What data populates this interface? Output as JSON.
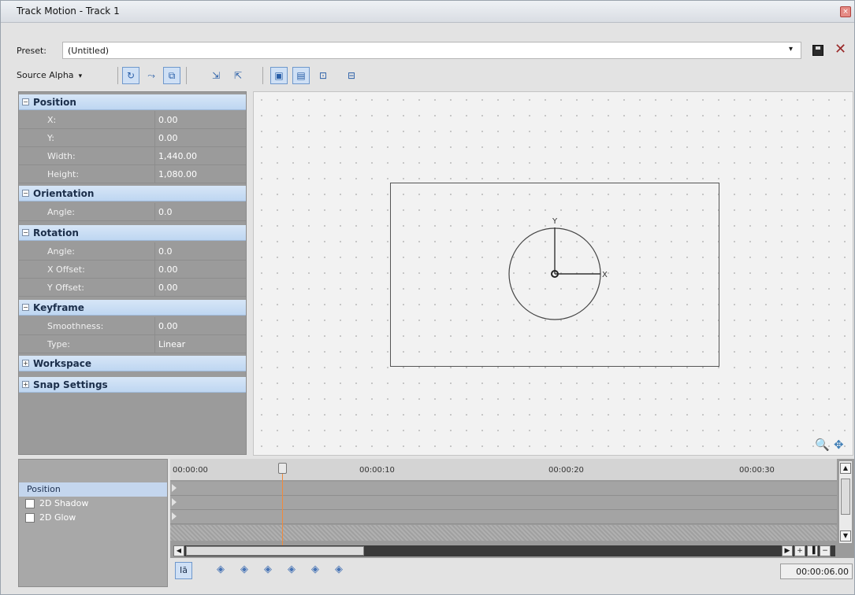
{
  "window": {
    "title": "Track Motion - Track 1",
    "close_glyph": "×"
  },
  "preset": {
    "label": "Preset:",
    "value": "(Untitled)",
    "dropdown_glyph": "▾",
    "delete_glyph": "✕"
  },
  "toolbar": {
    "source_alpha_label": "Source Alpha",
    "caret_glyph": "▾",
    "icons": {
      "rotate": "↻",
      "snap": "⤳",
      "prevent_move": "⧉",
      "lock_x": "⇲",
      "lock_y": "⇱",
      "edit_in_object_space": "▣",
      "enable_scale": "▤",
      "ortho1": "⊡",
      "ortho2": "⊟"
    }
  },
  "properties": {
    "position": {
      "title": "Position",
      "expander": "−",
      "rows": [
        {
          "key": "X:",
          "value": "0.00"
        },
        {
          "key": "Y:",
          "value": "0.00"
        },
        {
          "key": "Width:",
          "value": "1,440.00"
        },
        {
          "key": "Height:",
          "value": "1,080.00"
        }
      ]
    },
    "orientation": {
      "title": "Orientation",
      "expander": "−",
      "rows": [
        {
          "key": "Angle:",
          "value": "0.0"
        }
      ]
    },
    "rotation": {
      "title": "Rotation",
      "expander": "−",
      "rows": [
        {
          "key": "Angle:",
          "value": "0.0"
        },
        {
          "key": "X Offset:",
          "value": "0.00"
        },
        {
          "key": "Y Offset:",
          "value": "0.00"
        }
      ]
    },
    "keyframe": {
      "title": "Keyframe",
      "expander": "−",
      "rows": [
        {
          "key": "Smoothness:",
          "value": "0.00"
        },
        {
          "key": "Type:",
          "value": "Linear"
        }
      ]
    },
    "workspace": {
      "title": "Workspace",
      "expander": "+"
    },
    "snap_settings": {
      "title": "Snap Settings",
      "expander": "+"
    }
  },
  "canvas": {
    "axis_x_label": "X",
    "axis_y_label": "Y",
    "zoom_glyph": "🔍",
    "move_glyph": "✥"
  },
  "timeline": {
    "tracks": [
      {
        "label": "Position",
        "selected": true,
        "checkbox": false
      },
      {
        "label": "2D Shadow",
        "selected": false,
        "checkbox": true
      },
      {
        "label": "2D Glow",
        "selected": false,
        "checkbox": true
      }
    ],
    "ruler": [
      "00:00:00",
      "00:00:10",
      "00:00:20",
      "00:00:30"
    ],
    "scroll": {
      "up": "▲",
      "down": "▼",
      "left": "◀",
      "right": "▶",
      "plus": "+",
      "minus": "−",
      "menu": "▐"
    },
    "sync_label": "Iā",
    "keyframe_glyph": "◈",
    "timecode": "00:00:06.00"
  }
}
